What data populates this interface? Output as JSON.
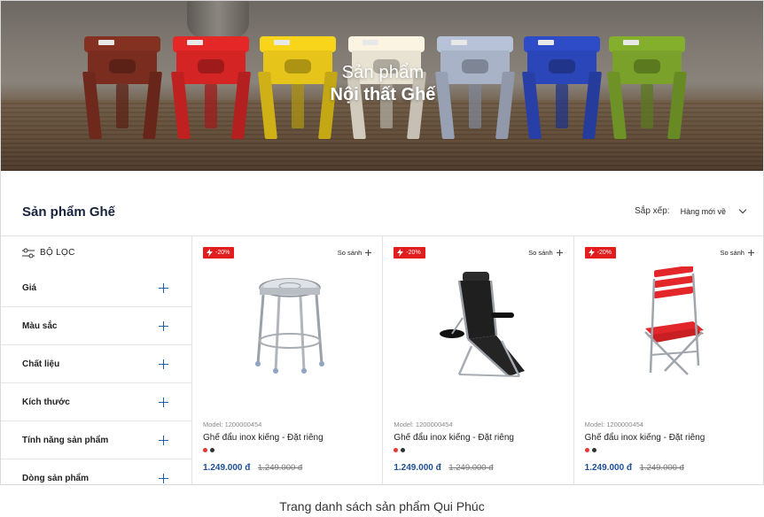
{
  "hero": {
    "subtitle": "Sản phẩm",
    "title": "Nội thất Ghế",
    "stool_colors": [
      "#7a2d1f",
      "#d42424",
      "#e6c419",
      "#e8e2d2",
      "#a9b3c8",
      "#2b46b8",
      "#7aa22a"
    ]
  },
  "header": {
    "title": "Sản phẩm Ghế",
    "sort_label": "Sắp xếp:",
    "sort_value": "Hàng mới về"
  },
  "sidebar": {
    "filter_label": "BỘ LỌC",
    "facets": [
      {
        "label": "Giá"
      },
      {
        "label": "Màu sắc"
      },
      {
        "label": "Chất liệu"
      },
      {
        "label": "Kích thước"
      },
      {
        "label": "Tính năng sản phẩm"
      },
      {
        "label": "Dòng sản phẩm"
      }
    ]
  },
  "products": [
    {
      "badge": "-20%",
      "compare": "So sánh",
      "model": "Model: 1200000454",
      "name": "Ghế đẩu inox kiếng - Đặt riêng",
      "price": "1.249.000 đ",
      "old_price": "1.249.000 đ",
      "swatches": [
        "#e53935",
        "#333333"
      ],
      "image_icon": "steel-stool-icon"
    },
    {
      "badge": "-20%",
      "compare": "So sánh",
      "model": "Model: 1200000454",
      "name": "Ghế đẩu inox kiếng - Đặt riêng",
      "price": "1.249.000 đ",
      "old_price": "1.249.000 đ",
      "swatches": [
        "#e53935",
        "#333333"
      ],
      "image_icon": "recliner-chair-icon"
    },
    {
      "badge": "-20%",
      "compare": "So sánh",
      "model": "Model: 1200000454",
      "name": "Ghế đẩu inox kiếng - Đặt riêng",
      "price": "1.249.000 đ",
      "old_price": "1.249.000 đ",
      "swatches": [
        "#e53935",
        "#333333"
      ],
      "image_icon": "folding-chair-icon"
    }
  ],
  "caption": "Trang danh sách sản phẩm Qui Phúc",
  "colors": {
    "accent": "#1c4f94",
    "badge": "#e11d1d",
    "title": "#17233d"
  }
}
